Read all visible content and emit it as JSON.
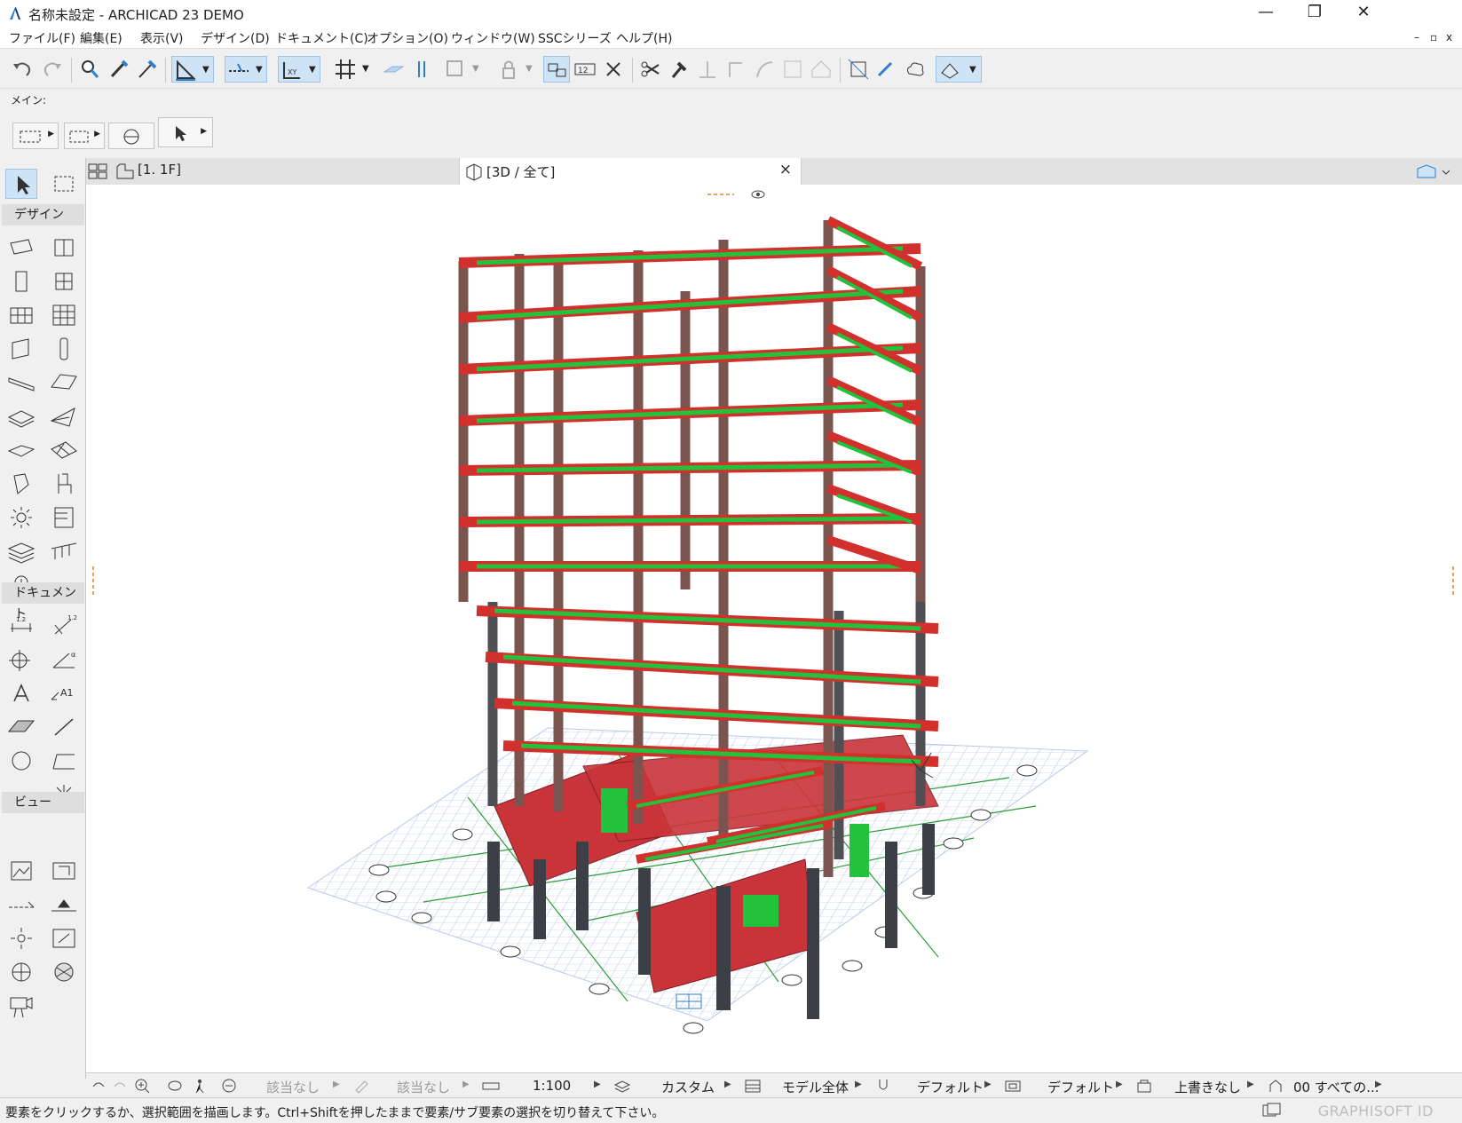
{
  "window": {
    "title": "名称未設定 - ARCHICAD 23 DEMO",
    "minimize": "—",
    "restore": "❐",
    "close": "✕"
  },
  "menu": {
    "items": [
      {
        "label": "ファイル(F)"
      },
      {
        "label": "編集(E)"
      },
      {
        "label": "表示(V)"
      },
      {
        "label": "デザイン(D)"
      },
      {
        "label": "ドキュメント(C)"
      },
      {
        "label": "オプション(O)"
      },
      {
        "label": "ウィンドウ(W)"
      },
      {
        "label": "SSCシリーズ"
      },
      {
        "label": "ヘルプ(H)"
      }
    ],
    "mdi": {
      "minimize": "–",
      "restore": "▫",
      "close": "x"
    }
  },
  "infobox": {
    "label": "メイン:"
  },
  "toolbox": {
    "groups": {
      "design": "デザイン",
      "document": "ドキュメント",
      "view": "ビュー"
    }
  },
  "tabs": {
    "plan": "[1. 1F]",
    "view3d": "[3D / 全て]",
    "close": "×"
  },
  "bottombar": {
    "undo_filter": "該当なし",
    "override": "該当なし",
    "scale": "1:100",
    "layer_combo": "カスタム",
    "model_view": "モデル全体",
    "pen_set": "デフォルト",
    "dimension": "デフォルト",
    "renovation": "上書きなし",
    "structure": "00 すべての..."
  },
  "status": {
    "message": "要素をクリックするか、選択範囲を描画します。Ctrl+Shiftを押したままで要素/サブ要素の選択を切り替えて下さい。",
    "graphisoft": "GRAPHISOFT ID"
  },
  "colors": {
    "beam_red": "#d2302c",
    "rebar_green": "#23c23c",
    "column_brown": "#7a5550",
    "column_dark": "#3c3f46",
    "grid_blue": "#b9c9ea",
    "accent_blue": "#2f7fd1"
  },
  "icons": [
    "undo-icon",
    "redo-icon",
    "pick-icon",
    "eyedropper-icon",
    "inject-icon",
    "guide-icon",
    "snap-icon",
    "grid-icon",
    "select-arrow-icon",
    "marquee-icon"
  ]
}
